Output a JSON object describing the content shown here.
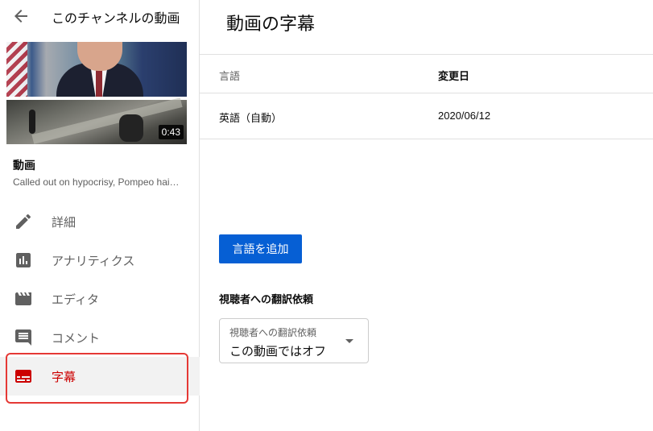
{
  "sidebar": {
    "title": "このチャンネルの動画",
    "video": {
      "duration": "0:43",
      "label": "動画",
      "description": "Called out on hypocrisy, Pompeo hai…"
    },
    "items": [
      {
        "label": "詳細",
        "icon": "pencil-icon"
      },
      {
        "label": "アナリティクス",
        "icon": "analytics-icon"
      },
      {
        "label": "エディタ",
        "icon": "clapperboard-icon"
      },
      {
        "label": "コメント",
        "icon": "comment-icon"
      },
      {
        "label": "字幕",
        "icon": "subtitles-icon",
        "active": true
      }
    ],
    "colors": {
      "active_text": "#cc0000",
      "highlight_border": "#e53935"
    }
  },
  "main": {
    "title": "動画の字幕",
    "table": {
      "headers": [
        "言語",
        "変更日"
      ],
      "rows": [
        [
          "英語（自動）",
          "2020/06/12"
        ]
      ]
    },
    "add_button_label": "言語を追加",
    "translation_section": {
      "label": "視聴者への翻訳依頼",
      "select_label": "視聴者への翻訳依頼",
      "select_value": "この動画ではオフ"
    },
    "colors": {
      "primary_button": "#065fd4"
    }
  }
}
